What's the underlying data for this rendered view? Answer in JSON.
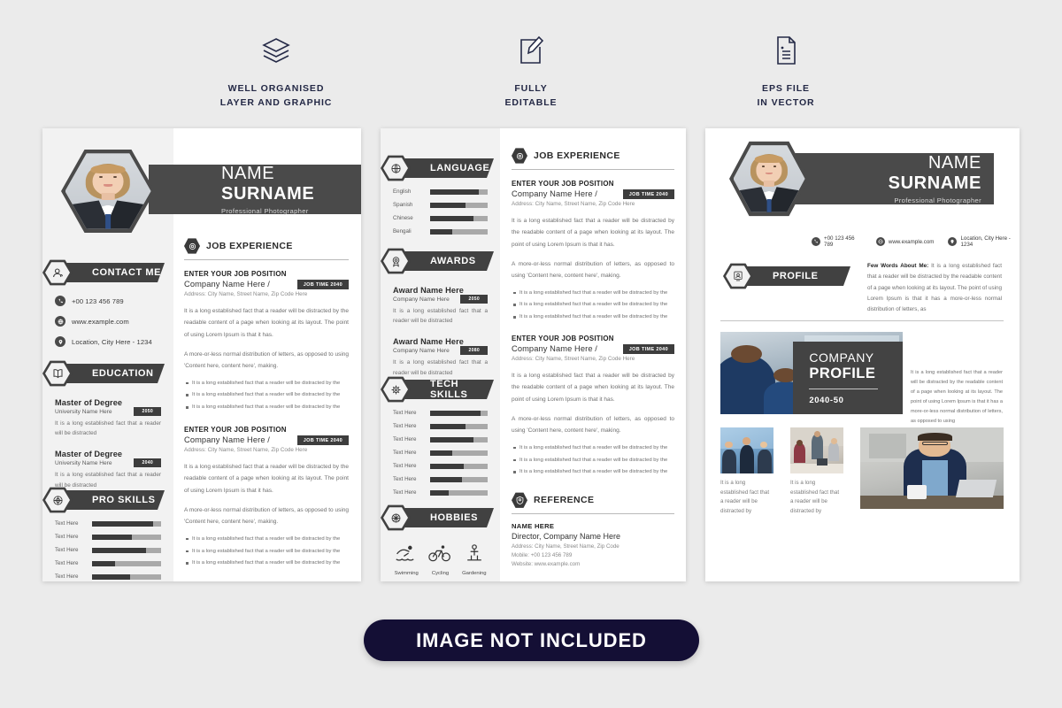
{
  "features": [
    {
      "icon": "layers-icon",
      "line1": "WELL ORGANISED",
      "line2": "LAYER AND GRAPHIC"
    },
    {
      "icon": "edit-pencil-icon",
      "line1": "FULLY",
      "line2": "EDITABLE"
    },
    {
      "icon": "file-document-icon",
      "line1": "EPS FILE",
      "line2": "IN VECTOR"
    }
  ],
  "person": {
    "first_name": "NAME",
    "last_name": "SURNAME",
    "role": "Professional Photographer"
  },
  "contact": {
    "heading": "CONTACT ME",
    "icon": "user-contact-icon",
    "items": [
      {
        "icon": "phone-icon",
        "text": "+00 123 456 789"
      },
      {
        "icon": "globe-icon",
        "text": "www.example.com"
      },
      {
        "icon": "location-pin-icon",
        "text": "Location, City Here - 1234"
      }
    ]
  },
  "education": {
    "heading": "EDUCATION",
    "icon": "book-icon",
    "items": [
      {
        "title": "Master of Degree",
        "subtitle": "University Name Here",
        "year": "2050",
        "desc": "It is a long established fact that a reader will be distracted"
      },
      {
        "title": "Master of Degree",
        "subtitle": "University Name Here",
        "year": "2040",
        "desc": "It is a long established fact that a reader will be distracted"
      }
    ]
  },
  "pro_skills": {
    "heading": "PRO SKILLS",
    "icon": "globe-skill-icon",
    "items": [
      {
        "label": "Text Here",
        "value": 88
      },
      {
        "label": "Text Here",
        "value": 58
      },
      {
        "label": "Text Here",
        "value": 78
      },
      {
        "label": "Text Here",
        "value": 33
      },
      {
        "label": "Text Here",
        "value": 55
      }
    ]
  },
  "language": {
    "heading": "LANGUAGE",
    "icon": "language-globe-icon",
    "items": [
      {
        "label": "English",
        "value": 85
      },
      {
        "label": "Spanish",
        "value": 62
      },
      {
        "label": "Chinese",
        "value": 76
      },
      {
        "label": "Bengali",
        "value": 38
      }
    ]
  },
  "awards": {
    "heading": "AWARDS",
    "icon": "award-medal-icon",
    "items": [
      {
        "title": "Award Name Here",
        "subtitle": "Company Name Here",
        "year": "2050",
        "desc": "It is a long established fact that a reader will be distracted"
      },
      {
        "title": "Award Name Here",
        "subtitle": "Company Name Here",
        "year": "2080",
        "desc": "It is a long established fact that a reader will be distracted"
      }
    ]
  },
  "tech_skills": {
    "heading": "TECH SKILLS",
    "icon": "gear-chip-icon",
    "items": [
      {
        "label": "Text Here",
        "value": 88
      },
      {
        "label": "Text Here",
        "value": 62
      },
      {
        "label": "Text Here",
        "value": 76
      },
      {
        "label": "Text Here",
        "value": 38
      },
      {
        "label": "Text Here",
        "value": 58
      },
      {
        "label": "Text Here",
        "value": 56
      },
      {
        "label": "Text Here",
        "value": 33
      }
    ]
  },
  "hobbies": {
    "heading": "HOBBIES",
    "icon": "hobbies-globe-icon",
    "items": [
      {
        "icon": "swimming-icon",
        "label": "Swimming"
      },
      {
        "icon": "cycling-icon",
        "label": "Cycling"
      },
      {
        "icon": "gardening-icon",
        "label": "Gardening"
      }
    ]
  },
  "job_experience": {
    "heading": "JOB EXPERIENCE",
    "icon": "briefcase-badge-icon",
    "entries": [
      {
        "position": "ENTER YOUR JOB POSITION",
        "company": "Company Name Here /",
        "time": "JOB TIME 2040",
        "address": "Address: City Name, Street Name, Zip Code Here",
        "para1": "It is a long established fact that a reader will be distracted by the readable content of a page when looking at its layout. The point of using Lorem Ipsum is that it has.",
        "para2": "A more-or-less normal distribution of letters, as opposed to using 'Content here, content here', making.",
        "bullets": [
          "It is a long established fact that a reader will be distracted by the",
          "It is a long established fact that a reader will be distracted by the",
          "It is a long established fact that a reader will be distracted by the"
        ]
      },
      {
        "position": "ENTER YOUR JOB POSITION",
        "company": "Company Name Here /",
        "time": "JOB TIME 2040",
        "address": "Address: City Name, Street Name, Zip Code Here",
        "para1": "It is a long established fact that a reader will be distracted by the readable content of a page when looking at its layout. The point of using Lorem Ipsum is that it has.",
        "para2": "A more-or-less normal distribution of letters, as opposed to using 'Content here, content here', making.",
        "bullets": [
          "It is a long established fact that a reader will be distracted by the",
          "It is a long established fact that a reader will be distracted by the",
          "It is a long established fact that a reader will be distracted by the"
        ]
      }
    ]
  },
  "reference": {
    "heading": "REFERENCE",
    "icon": "reference-shield-icon",
    "name": "NAME HERE",
    "role": "Director, Company Name Here",
    "address": "Address: City Name, Street Name, Zip Code",
    "mobile": "Mobile: +00 123 456 789",
    "website": "Website: www.example.com"
  },
  "profile": {
    "heading": "PROFILE",
    "icon": "profile-card-icon",
    "lead": "Few Words About Me:",
    "text": " It is a long established fact that a reader will be distracted by the readable content of a page when looking at its layout. The point of using Lorem Ipsum is that it has a more-or-less normal distribution of letters, as"
  },
  "company_profile": {
    "line1": "COMPANY",
    "line2": "PROFILE",
    "year": "2040-50",
    "text": "It is a long established fact that a reader will be distracted by the readable content of a page when looking at its layout. The point of using Lorem Ipsum is that it has a more-or-less normal distribution of letters, as opposed to using"
  },
  "thumbnails": [
    {
      "caption": "It is a long established fact that a reader will be distracted by"
    },
    {
      "caption": "It is a long established fact that a reader will be distracted by"
    }
  ],
  "badge": {
    "label": "IMAGE NOT INCLUDED"
  },
  "colors": {
    "dark": "#414141",
    "page_bg": "#ffffff",
    "sidebar_bg": "#f2f2f2",
    "canvas_bg": "#ebebeb",
    "badge_bg": "#140f35",
    "bar_track": "#a9a9a9",
    "bar_fill": "#3b3b3b"
  }
}
